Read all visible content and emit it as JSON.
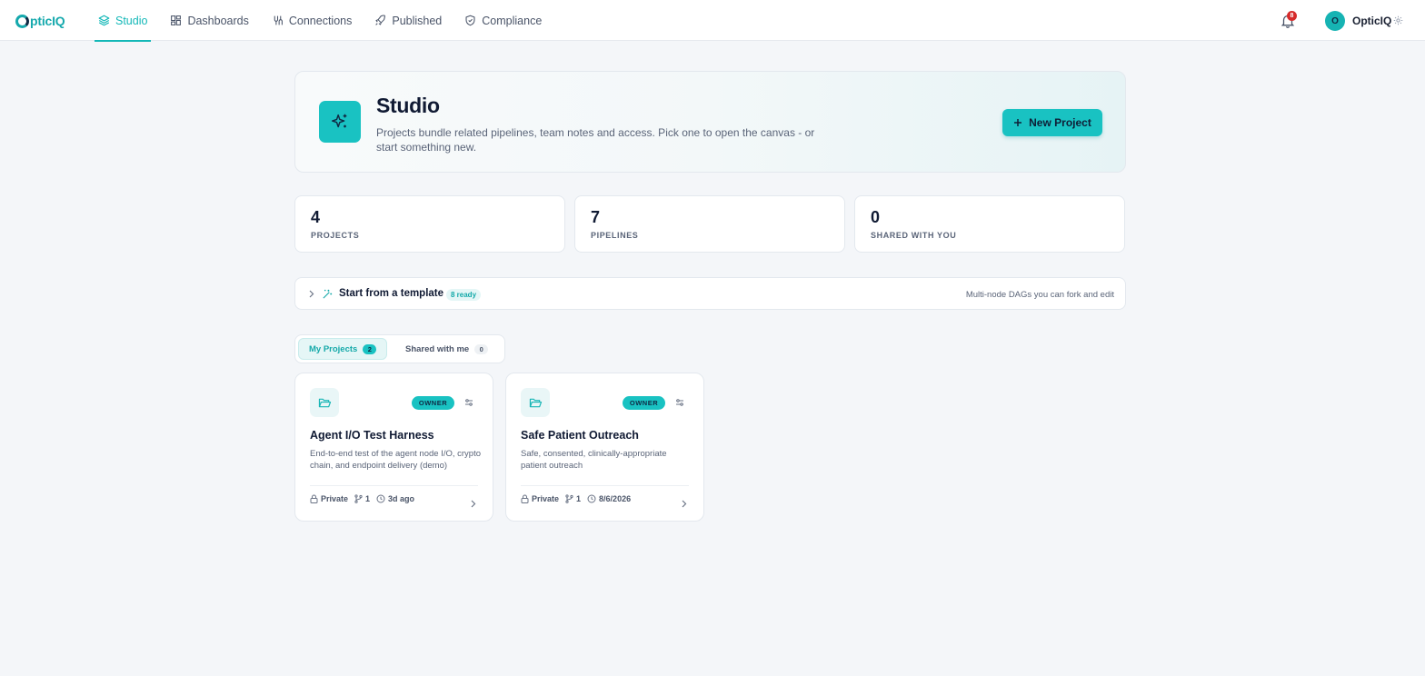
{
  "brand": {
    "logo_prefix": "pticIQ",
    "logo_first": "O"
  },
  "nav": {
    "items": [
      {
        "label": "Studio",
        "icon": "layers-icon",
        "active": true
      },
      {
        "label": "Dashboards",
        "icon": "grid-icon"
      },
      {
        "label": "Connections",
        "icon": "plug-icon"
      },
      {
        "label": "Published",
        "icon": "rocket-icon"
      },
      {
        "label": "Compliance",
        "icon": "shield-icon"
      }
    ]
  },
  "header": {
    "notifications_count": "8",
    "avatar_initial": "O",
    "user_name": "OpticIQ"
  },
  "hero": {
    "title": "Studio",
    "description": "Projects bundle related pipelines, team notes and access. Pick one to open the canvas - or start something new.",
    "new_button_label": "New Project"
  },
  "stats": [
    {
      "value": "4",
      "label": "PROJECTS"
    },
    {
      "value": "7",
      "label": "PIPELINES"
    },
    {
      "value": "0",
      "label": "SHARED WITH YOU"
    }
  ],
  "template_bar": {
    "title": "Start from a template",
    "badge": "8 ready",
    "hint": "Multi-node DAGs you can fork and edit"
  },
  "tabs": [
    {
      "label": "My Projects",
      "count": "2",
      "active": true
    },
    {
      "label": "Shared with me",
      "count": "0",
      "active": false
    }
  ],
  "projects": [
    {
      "role": "OWNER",
      "title": "Agent I/O Test Harness",
      "description": "End-to-end test of the agent node I/O, crypto chain, and endpoint delivery (demo)",
      "visibility": "Private",
      "pipelines": "1",
      "updated": "3d ago"
    },
    {
      "role": "OWNER",
      "title": "Safe Patient Outreach",
      "description": "Safe, consented, clinically-appropriate patient outreach",
      "visibility": "Private",
      "pipelines": "1",
      "updated": "8/6/2026"
    }
  ],
  "colors": {
    "accent": "#19c2c2",
    "accent_text": "#14b8b8",
    "navy": "#101a33",
    "badge_red": "#d62b2b",
    "page_bg": "#f4f6f9"
  }
}
